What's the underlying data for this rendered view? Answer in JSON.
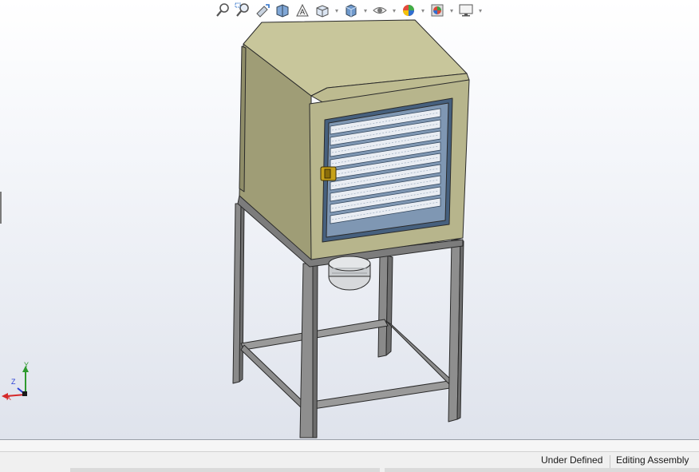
{
  "toolbar": {
    "icons": [
      "zoom-to-fit-icon",
      "zoom-to-area-icon",
      "previous-view-icon",
      "section-view-icon",
      "dynamic-annotation-icon",
      "view-orientation-icon",
      "display-style-icon",
      "hide-show-items-icon",
      "edit-appearance-icon",
      "apply-scene-icon",
      "view-settings-icon"
    ]
  },
  "colors": {
    "cabinet": "#b7b58c",
    "cabinet_light": "#c8c69b",
    "cabinet_dark": "#9f9d76",
    "frame": "#8a8a8a",
    "glass": "#7f97b3",
    "tray": "#e9edf3",
    "latch": "#c6a11a"
  },
  "triad": {
    "y": "Y",
    "z": "Z",
    "x": "X"
  },
  "status": {
    "definition": "Under Defined",
    "mode": "Editing Assembly"
  }
}
